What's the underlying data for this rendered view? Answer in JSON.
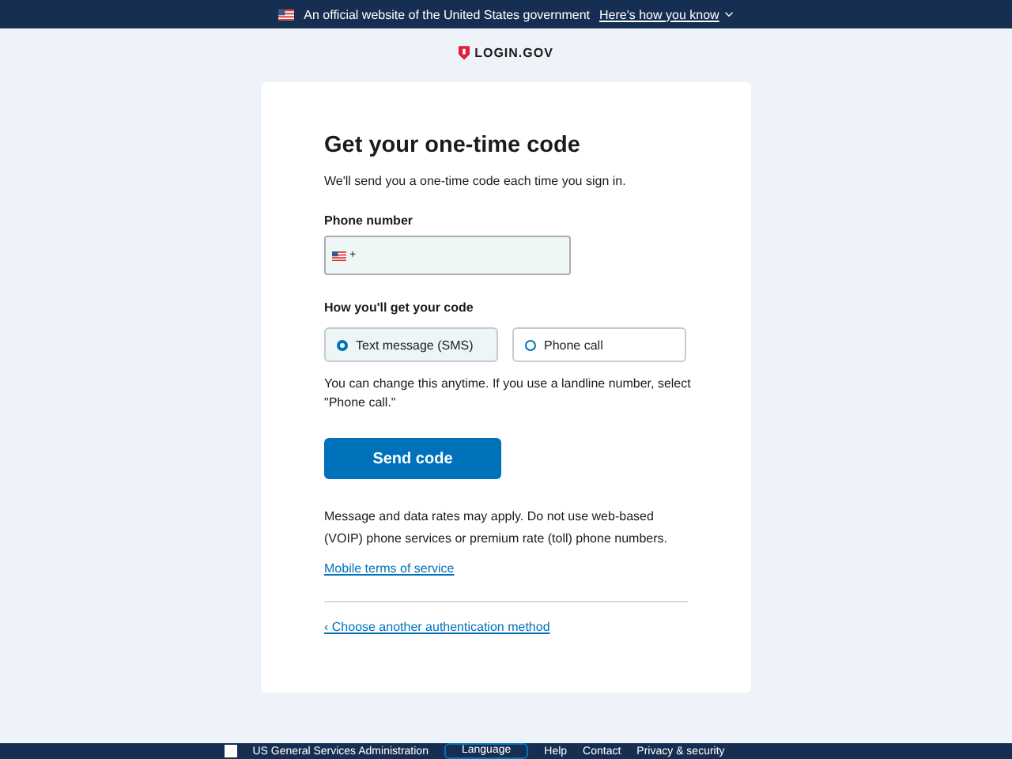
{
  "banner": {
    "text": "An official website of the United States government",
    "link": "Here's how you know"
  },
  "logo": "LOGIN.GOV",
  "title": "Get your one-time code",
  "intro": "We'll send you a one-time code each time you sign in.",
  "phone": {
    "label": "Phone number",
    "country_code": "+"
  },
  "delivery": {
    "label": "How you'll get your code",
    "options": [
      {
        "label": "Text message (SMS)",
        "selected": true
      },
      {
        "label": "Phone call",
        "selected": false
      }
    ]
  },
  "hint": "You can change this anytime. If you use a landline number, select \"Phone call.\"",
  "submit": "Send code",
  "notice": "Message and data rates may apply. Do not use web-based (VOIP) phone services or premium rate (toll) phone numbers.",
  "terms_link": "Mobile terms of service",
  "back_link": "‹ Choose another authentication method",
  "footer": {
    "agency": "US General Services Administration",
    "language": "Language",
    "links": [
      "Help",
      "Contact",
      "Privacy & security"
    ]
  }
}
